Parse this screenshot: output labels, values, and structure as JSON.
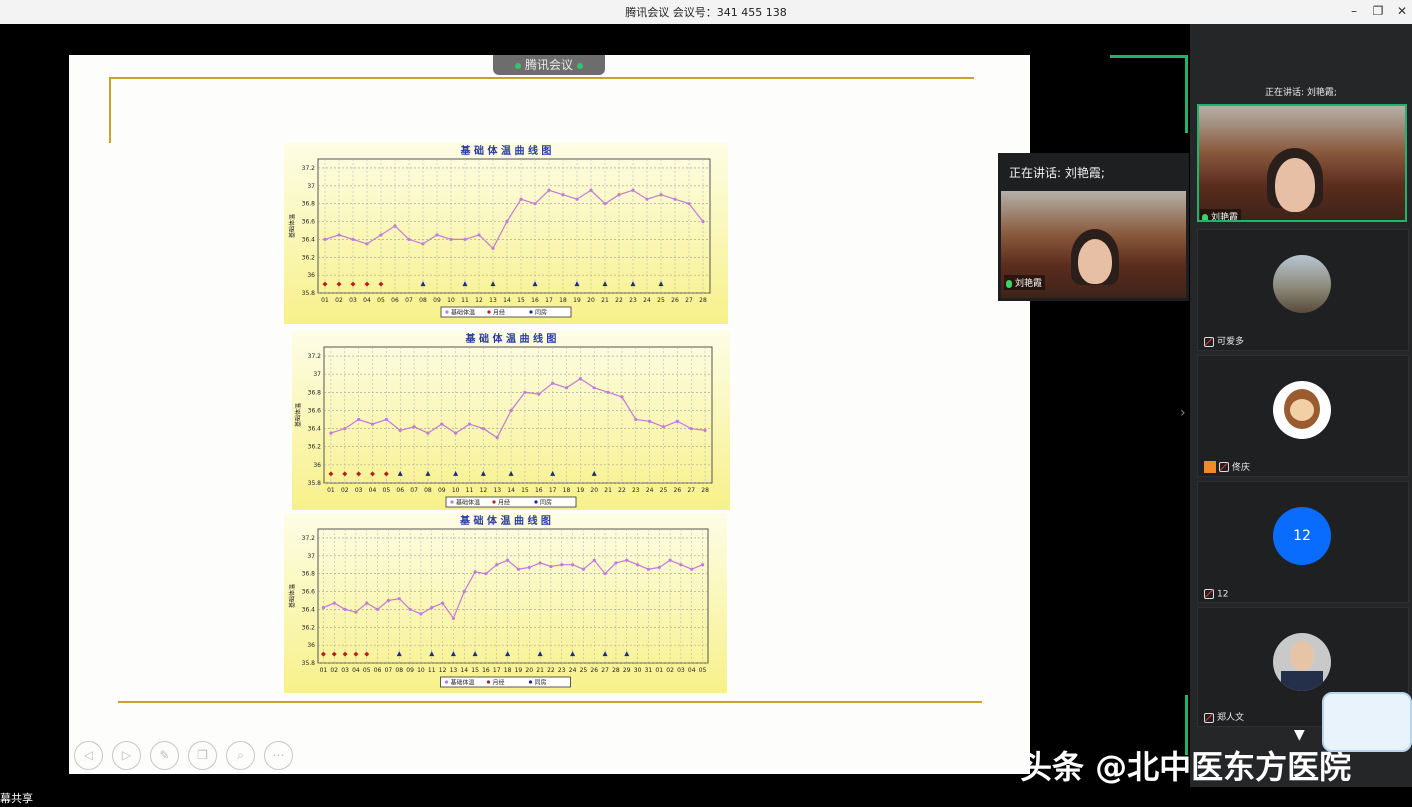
{
  "window": {
    "title": "腾讯会议 会议号：341 455 138",
    "minimize": "–",
    "restore": "❐",
    "close": "✕"
  },
  "share_pill": {
    "label": "腾讯会议"
  },
  "chart_data": [
    {
      "type": "line",
      "title": "基 础 体 温 曲 线 图",
      "ylabel": "基础体温",
      "ylim": [
        35.8,
        37.3
      ],
      "yticks": [
        "37.2",
        "37",
        "36.8",
        "36.6",
        "36.4",
        "36.2",
        "36",
        "35.8"
      ],
      "x": [
        "01",
        "02",
        "03",
        "04",
        "05",
        "06",
        "07",
        "08",
        "09",
        "10",
        "11",
        "12",
        "13",
        "14",
        "15",
        "16",
        "17",
        "18",
        "19",
        "20",
        "21",
        "22",
        "23",
        "24",
        "25",
        "26",
        "27",
        "28"
      ],
      "series": [
        {
          "name": "基础体温",
          "values": [
            36.4,
            36.45,
            36.4,
            36.35,
            36.45,
            36.55,
            36.4,
            36.35,
            36.45,
            36.4,
            36.4,
            36.45,
            36.3,
            36.6,
            36.85,
            36.8,
            36.95,
            36.9,
            36.85,
            36.95,
            36.8,
            36.9,
            36.95,
            36.85,
            36.9,
            36.85,
            36.8,
            36.6
          ]
        },
        {
          "name": "月经",
          "days": [
            "01",
            "02",
            "03",
            "04",
            "05"
          ]
        },
        {
          "name": "同房",
          "days": [
            "08",
            "11",
            "13",
            "16",
            "19",
            "21",
            "23",
            "25"
          ]
        }
      ],
      "legend": [
        "基础体温",
        "月经",
        "同房"
      ]
    },
    {
      "type": "line",
      "title": "基 础 体 温 曲 线 图",
      "ylabel": "基础体温",
      "ylim": [
        35.8,
        37.3
      ],
      "yticks": [
        "37.2",
        "37",
        "36.8",
        "36.6",
        "36.4",
        "36.2",
        "36",
        "35.8"
      ],
      "x": [
        "01",
        "02",
        "03",
        "04",
        "05",
        "06",
        "07",
        "08",
        "09",
        "10",
        "11",
        "12",
        "13",
        "14",
        "15",
        "16",
        "17",
        "18",
        "19",
        "20",
        "21",
        "22",
        "23",
        "24",
        "25",
        "26",
        "27",
        "28"
      ],
      "series": [
        {
          "name": "基础体温",
          "values": [
            36.35,
            36.4,
            36.5,
            36.45,
            36.5,
            36.38,
            36.42,
            36.35,
            36.45,
            36.35,
            36.45,
            36.4,
            36.3,
            36.6,
            36.8,
            36.78,
            36.9,
            36.85,
            36.95,
            36.85,
            36.8,
            36.75,
            36.5,
            36.48,
            36.42,
            36.48,
            36.4,
            36.38
          ]
        },
        {
          "name": "月经",
          "days": [
            "01",
            "02",
            "03",
            "04",
            "05"
          ]
        },
        {
          "name": "同房",
          "days": [
            "06",
            "08",
            "10",
            "12",
            "14",
            "17",
            "20"
          ]
        }
      ],
      "legend": [
        "基础体温",
        "月经",
        "同房"
      ]
    },
    {
      "type": "line",
      "title": "基 础 体 温 曲 线 图",
      "ylabel": "基础体温",
      "ylim": [
        35.8,
        37.3
      ],
      "yticks": [
        "37.2",
        "37",
        "36.8",
        "36.6",
        "36.4",
        "36.2",
        "36",
        "35.8"
      ],
      "x": [
        "01",
        "02",
        "03",
        "04",
        "05",
        "06",
        "07",
        "08",
        "09",
        "10",
        "11",
        "12",
        "13",
        "14",
        "15",
        "16",
        "17",
        "18",
        "19",
        "20",
        "21",
        "22",
        "23",
        "24",
        "25",
        "26",
        "27",
        "28",
        "29",
        "30",
        "31",
        "01",
        "02",
        "03",
        "04",
        "05"
      ],
      "series": [
        {
          "name": "基础体温",
          "values": [
            36.42,
            36.47,
            36.4,
            36.37,
            36.47,
            36.4,
            36.5,
            36.52,
            36.4,
            36.35,
            36.42,
            36.47,
            36.3,
            36.6,
            36.82,
            36.8,
            36.9,
            36.95,
            36.85,
            36.87,
            36.92,
            36.88,
            36.9,
            36.9,
            36.85,
            36.95,
            36.8,
            36.92,
            36.95,
            36.9,
            36.85,
            36.87,
            36.95,
            36.9,
            36.85,
            36.9
          ]
        },
        {
          "name": "月经",
          "days": [
            "01",
            "02",
            "03",
            "04",
            "05"
          ]
        },
        {
          "name": "同房",
          "days": [
            "08",
            "11",
            "13",
            "15",
            "18",
            "21",
            "24",
            "27",
            "29"
          ]
        }
      ],
      "legend": [
        "基础体温",
        "月经",
        "同房"
      ]
    }
  ],
  "colors": {
    "line": "#c27bd8",
    "period": "#b22222",
    "intercourse": "#1f2a8c",
    "title_blue": "#2b3ea0",
    "accent_green": "#1fb36b",
    "gold": "#c9a227"
  },
  "slide_controls": [
    "prev-icon",
    "next-icon",
    "pen-icon",
    "copy-icon",
    "zoom-icon",
    "more-icon"
  ],
  "speaker": {
    "label": "正在讲话: 刘艳霞;",
    "name": "刘艳霞"
  },
  "sidebar": {
    "speaking_label": "正在讲话: 刘艳霞;",
    "participants": [
      {
        "name": "刘艳霞",
        "kind": "video"
      },
      {
        "name": "可爱多",
        "kind": "avatar-photo"
      },
      {
        "name": "佟庆",
        "kind": "avatar-monkey"
      },
      {
        "name": "12",
        "kind": "avatar-number",
        "badge": "12"
      },
      {
        "name": "郑人文",
        "kind": "avatar-photo"
      }
    ]
  },
  "watermark": "头条 @北中医东方医院",
  "bottom_label": "幕共享"
}
